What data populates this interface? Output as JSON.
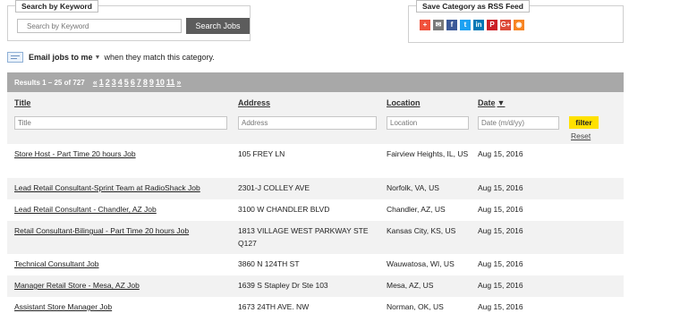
{
  "keyword_search": {
    "legend": "Search by Keyword",
    "placeholder": "Search by Keyword",
    "button_label": "Search Jobs"
  },
  "rss": {
    "legend": "Save Category as RSS Feed",
    "icons": [
      {
        "name": "addthis-icon",
        "glyph": "+",
        "color": "#f0513b"
      },
      {
        "name": "email-icon",
        "glyph": "✉",
        "color": "#7a7a7a"
      },
      {
        "name": "facebook-icon",
        "glyph": "f",
        "color": "#3b5998"
      },
      {
        "name": "twitter-icon",
        "glyph": "t",
        "color": "#1da1f2"
      },
      {
        "name": "linkedin-icon",
        "glyph": "in",
        "color": "#0077b5"
      },
      {
        "name": "pinterest-icon",
        "glyph": "P",
        "color": "#cb2027"
      },
      {
        "name": "googleplus-icon",
        "glyph": "G+",
        "color": "#dd4b39"
      },
      {
        "name": "rss-icon",
        "glyph": "◉",
        "color": "#f78422"
      }
    ]
  },
  "email_alert": {
    "label": "Email jobs to me",
    "suffix": "when they match this category."
  },
  "results": {
    "summary": "Results 1 – 25 of 727",
    "pager": [
      "«",
      "1",
      "2",
      "3",
      "4",
      "5",
      "6",
      "7",
      "8",
      "9",
      "10",
      "11",
      "»"
    ]
  },
  "table": {
    "headers": {
      "title": "Title",
      "address": "Address",
      "location": "Location",
      "date": "Date",
      "sort_indicator": "▼"
    },
    "filters": {
      "title_placeholder": "Title",
      "address_placeholder": "Address",
      "location_placeholder": "Location",
      "date_placeholder": "Date (m/d/yy)",
      "filter_label": "filter",
      "reset_label": "Reset"
    },
    "rows": [
      {
        "title": "Store Host - Part Time 20 hours Job",
        "address": "105 FREY LN",
        "location": "Fairview Heights, IL, US",
        "date": "Aug 15, 2016"
      },
      {
        "title": "Lead Retail Consultant-Sprint Team at RadioShack Job",
        "address": "2301-J COLLEY AVE",
        "location": "Norfolk, VA, US",
        "date": "Aug 15, 2016"
      },
      {
        "title": "Lead Retail Consultant - Chandler, AZ Job",
        "address": "3100 W CHANDLER BLVD",
        "location": "Chandler, AZ, US",
        "date": "Aug 15, 2016"
      },
      {
        "title": "Retail Consultant-Bilingual - Part Time 20 hours Job",
        "address": "1813 VILLAGE WEST PARKWAY STE Q127",
        "location": "Kansas City, KS, US",
        "date": "Aug 15, 2016"
      },
      {
        "title": "Technical Consultant Job",
        "address": "3860 N 124TH ST",
        "location": "Wauwatosa, WI, US",
        "date": "Aug 15, 2016"
      },
      {
        "title": "Manager Retail Store - Mesa, AZ Job",
        "address": "1639 S Stapley Dr Ste 103",
        "location": "Mesa, AZ, US",
        "date": "Aug 15, 2016"
      },
      {
        "title": "Assistant Store Manager Job",
        "address": "1673 24TH AVE. NW",
        "location": "Norman, OK, US",
        "date": "Aug 15, 2016"
      }
    ]
  }
}
